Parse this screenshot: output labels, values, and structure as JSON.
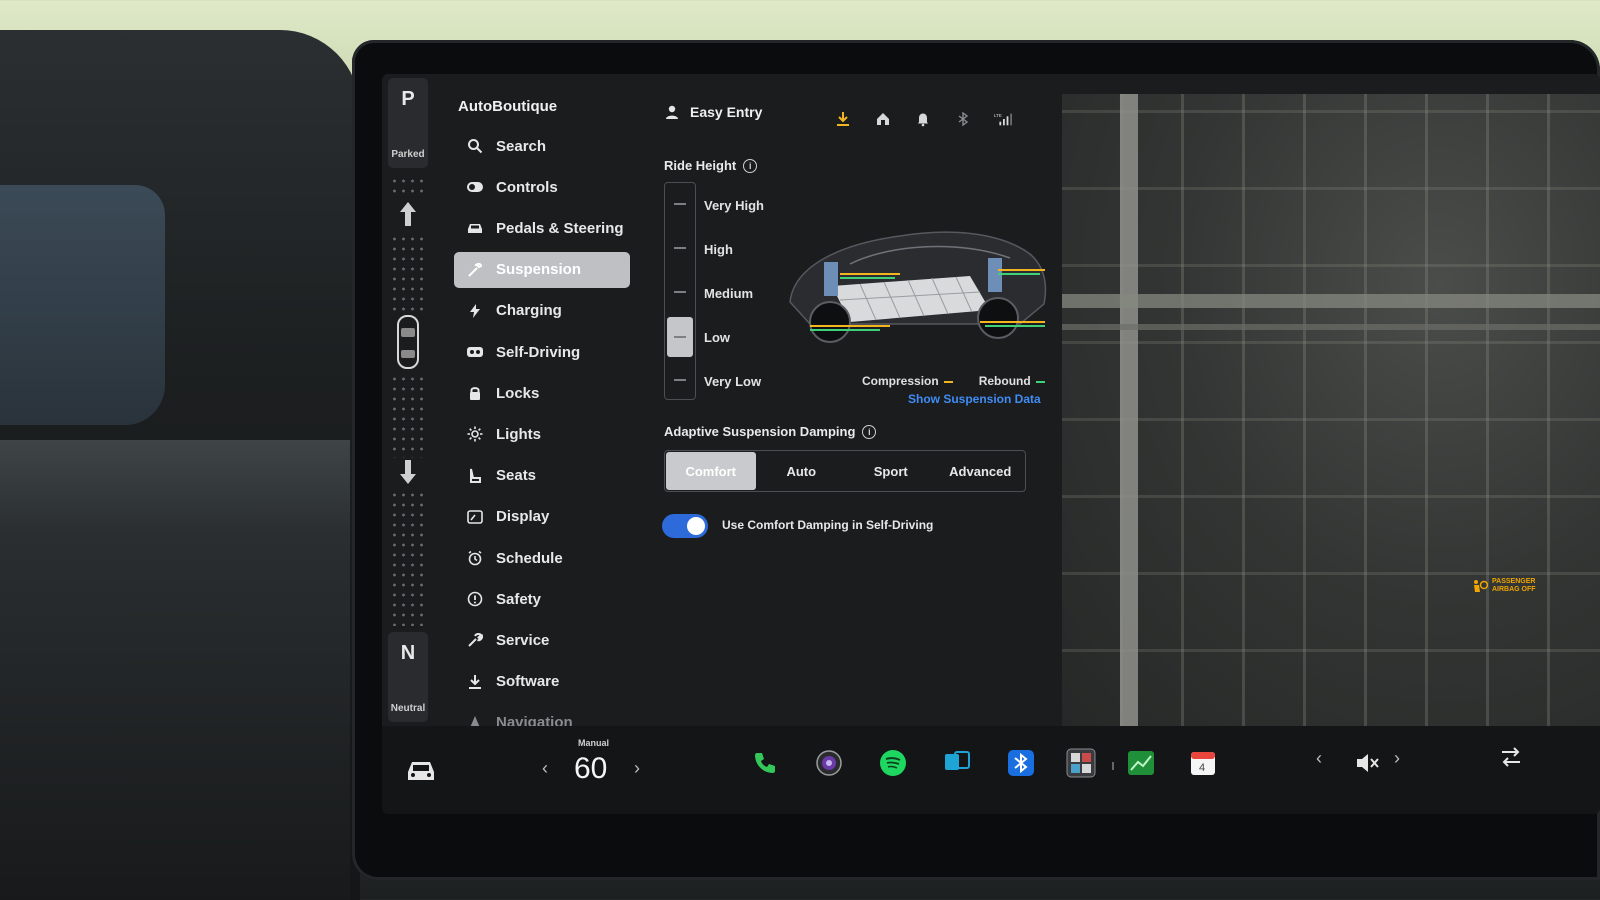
{
  "app": {
    "brand": "AutoBoutique"
  },
  "gear": {
    "top": {
      "letter": "P",
      "label": "Parked"
    },
    "bottom": {
      "letter": "N",
      "label": "Neutral"
    }
  },
  "menu": {
    "items": [
      {
        "label": "Search",
        "icon": "search-icon"
      },
      {
        "label": "Controls",
        "icon": "toggle-icon"
      },
      {
        "label": "Pedals & Steering",
        "icon": "car-icon"
      },
      {
        "label": "Suspension",
        "icon": "wrench-icon",
        "active": true
      },
      {
        "label": "Charging",
        "icon": "bolt-icon"
      },
      {
        "label": "Self-Driving",
        "icon": "steering-icon"
      },
      {
        "label": "Locks",
        "icon": "lock-icon"
      },
      {
        "label": "Lights",
        "icon": "sun-icon"
      },
      {
        "label": "Seats",
        "icon": "seat-icon"
      },
      {
        "label": "Display",
        "icon": "display-icon"
      },
      {
        "label": "Schedule",
        "icon": "clock-icon"
      },
      {
        "label": "Safety",
        "icon": "alert-icon"
      },
      {
        "label": "Service",
        "icon": "service-icon"
      },
      {
        "label": "Software",
        "icon": "download-icon"
      },
      {
        "label": "Navigation",
        "icon": "navigation-icon"
      }
    ]
  },
  "profile": {
    "name": "Easy Entry"
  },
  "status_icons": [
    "download-icon",
    "home-icon",
    "bell-icon",
    "bluetooth-icon",
    "lte-signal-icon"
  ],
  "ride_height": {
    "title": "Ride Height",
    "levels": [
      "Very High",
      "High",
      "Medium",
      "Low",
      "Very Low"
    ],
    "selected": "Low"
  },
  "legend": {
    "compression": "Compression",
    "rebound": "Rebound",
    "compression_color": "#f2b51f",
    "rebound_color": "#3fd07a"
  },
  "show_data_link": "Show Suspension Data",
  "damping": {
    "title": "Adaptive Suspension Damping",
    "options": [
      "Comfort",
      "Auto",
      "Sport",
      "Advanced"
    ],
    "selected": "Comfort"
  },
  "toggle": {
    "label": "Use Comfort Damping in Self-Driving",
    "on": true
  },
  "airbag": {
    "text": "PASSENGER AIRBAG OFF"
  },
  "dock": {
    "speed_mode": "Manual",
    "speed": "60",
    "apps": [
      "phone-icon",
      "camera-icon",
      "spotify-icon",
      "toybox-icon",
      "bluetooth-icon",
      "games-icon",
      "stocks-icon",
      "calendar-icon"
    ],
    "calendar_day": "4"
  },
  "colors": {
    "accent": "#2c6bd9",
    "link": "#3f8cf5",
    "active_bg": "#bfc0c4"
  }
}
